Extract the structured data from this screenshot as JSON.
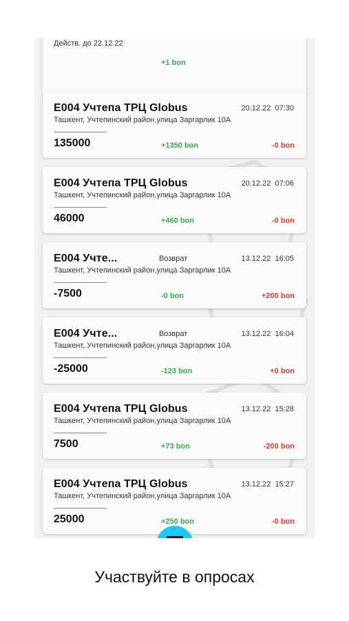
{
  "top_card": {
    "valid_until": "Действ. до 22.12.22",
    "bonus_plus": "+1 bon"
  },
  "transactions": [
    {
      "store": "E004 Учтепа ТРЦ Globus",
      "date": "20.12.22",
      "time": "07:30",
      "address": "Ташкент, Учтепинский район,улица Заргарлик 10А",
      "amount": "135000",
      "bonus_plus": "+1350 bon",
      "bonus_minus": "-0 bon"
    },
    {
      "store": "E004 Учтепа ТРЦ Globus",
      "date": "20.12.22",
      "time": "07:06",
      "address": "Ташкент, Учтепинский район,улица Заргарлик 10А",
      "amount": "46000",
      "bonus_plus": "+460 bon",
      "bonus_minus": "-0 bon"
    },
    {
      "store": "E004 Учте...",
      "type": "Возврат",
      "date": "13.12.22",
      "time": "16:05",
      "address": "Ташкент, Учтепинский район,улица Заргарлик 10А",
      "amount": "-7500",
      "bonus_plus": "-0 bon",
      "bonus_minus": "+200 bon"
    },
    {
      "store": "E004 Учте...",
      "type": "Возврат",
      "date": "13.12.22",
      "time": "16:04",
      "address": "Ташкент, Учтепинский район,улица Заргарлик 10А",
      "amount": "-25000",
      "bonus_plus": "-123 bon",
      "bonus_minus": "+0 bon"
    },
    {
      "store": "E004 Учтепа ТРЦ Globus",
      "date": "13.12.22",
      "time": "15:28",
      "address": "Ташкент, Учтепинский район,улица Заргарлик 10А",
      "amount": "7500",
      "bonus_plus": "+73 bon",
      "bonus_minus": "-200 bon"
    },
    {
      "store": "E004 Учтепа ТРЦ Globus",
      "date": "13.12.22",
      "time": "15:27",
      "address": "Ташкент, Учтепинский район,улица Заргарлик 10А",
      "amount": "25000",
      "bonus_plus": "+250 bon",
      "bonus_minus": "-0 bon"
    }
  ],
  "fab_icon": "menu-icon",
  "caption": "Участвуйте в опросах",
  "colors": {
    "bonus_positive": "#34a853",
    "bonus_negative": "#d93a2b",
    "fab": "#1ec6f0",
    "background": "#f1f1f1"
  }
}
